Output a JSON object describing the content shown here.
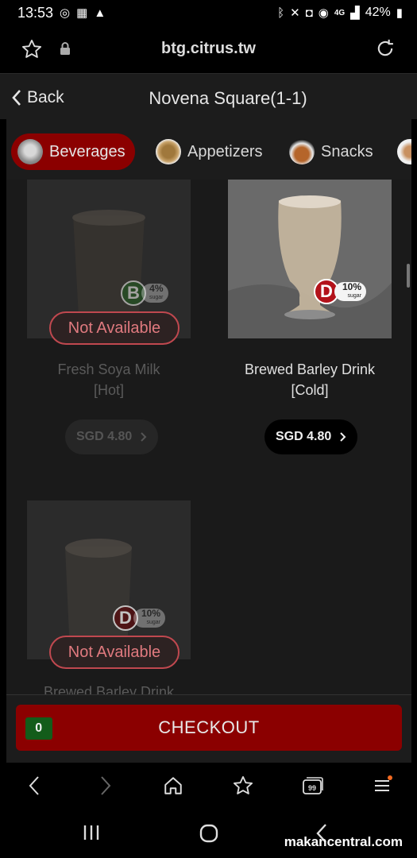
{
  "status": {
    "time": "13:53",
    "network": "4G",
    "battery": "42%"
  },
  "browser": {
    "url": "btg.citrus.tw"
  },
  "header": {
    "back_label": "Back",
    "title": "Novena Square(1-1)"
  },
  "tabs": [
    {
      "label": "Beverages",
      "active": true
    },
    {
      "label": "Appetizers",
      "active": false
    },
    {
      "label": "Snacks",
      "active": false
    }
  ],
  "products": [
    {
      "name_line1": "Fresh Soya Milk",
      "name_line2": "[Hot]",
      "price": "SGD 4.80",
      "available": false,
      "status": "Not Available",
      "grade": "B",
      "sugar": "4%",
      "sugar_unit": "sugar",
      "grade_color": "#1f7a1f"
    },
    {
      "name_line1": "Brewed Barley Drink",
      "name_line2": "[Cold]",
      "price": "SGD 4.80",
      "available": true,
      "status": "",
      "grade": "D",
      "sugar": "10%",
      "sugar_unit": "sugar",
      "grade_color": "#b3121a"
    },
    {
      "name_line1": "Brewed Barley Drink",
      "name_line2": "",
      "price": "",
      "available": false,
      "status": "Not Available",
      "grade": "D",
      "sugar": "10%",
      "sugar_unit": "sugar",
      "grade_color": "#b3121a"
    }
  ],
  "checkout": {
    "count": "0",
    "label": "CHECKOUT"
  },
  "watermark": "makancentral.com"
}
